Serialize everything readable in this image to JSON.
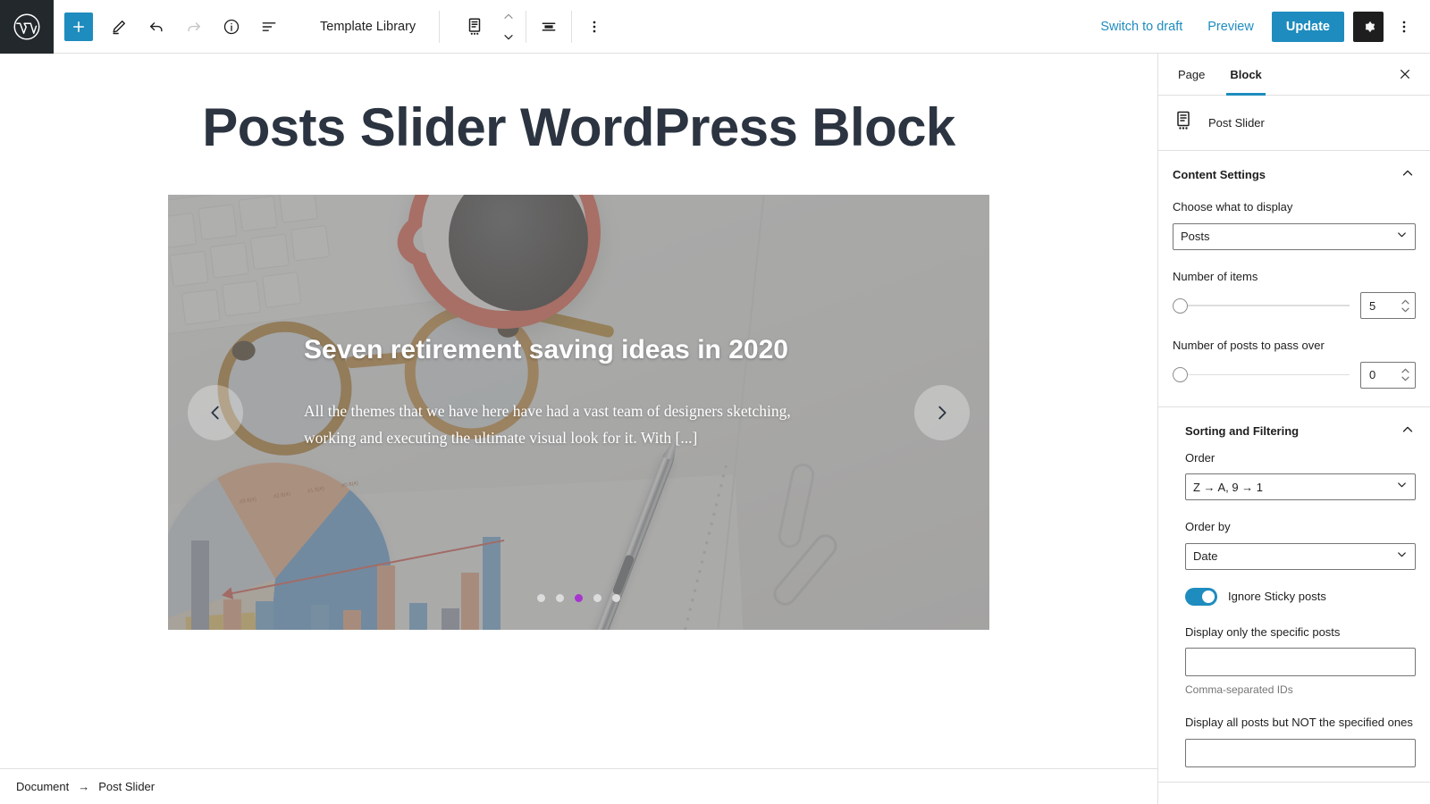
{
  "topbar": {
    "logo_icon": "wordpress-logo-icon",
    "add_block_label": "+",
    "tools_icon": "pencil-tools-icon",
    "undo_icon": "undo-icon",
    "redo_icon": "redo-icon",
    "info_icon": "info-circle-icon",
    "list_view_icon": "list-view-icon",
    "template_library_label": "Template Library",
    "block_icon": "post-slider-block-icon",
    "move_up_icon": "chevron-up-icon",
    "move_down_icon": "chevron-down-icon",
    "align_icon": "align-center-icon",
    "block_options_icon": "vertical-ellipsis-icon",
    "switch_to_draft_label": "Switch to draft",
    "preview_label": "Preview",
    "update_label": "Update",
    "settings_gear_icon": "gear-icon",
    "more_options_icon": "vertical-ellipsis-icon"
  },
  "canvas": {
    "page_title": "Posts Slider WordPress Block",
    "slider": {
      "prev_icon": "chevron-left-icon",
      "next_icon": "chevron-right-icon",
      "slide_title": "Seven retirement saving ideas in 2020",
      "slide_excerpt": "All the themes that we have here have had a vast team of designers sketching, working and executing the ultimate visual look for it. With [...]",
      "dot_count": 5,
      "active_dot_index": 2,
      "active_dot_color": "#a735d0",
      "inactive_dot_color": "#dcdcdc"
    }
  },
  "sidebar": {
    "tabs": [
      {
        "label": "Page",
        "active": false
      },
      {
        "label": "Block",
        "active": true
      }
    ],
    "close_icon": "close-icon",
    "block": {
      "icon": "post-slider-block-icon",
      "name": "Post Slider"
    },
    "panels": [
      {
        "title": "Content Settings",
        "toggle_icon": "chevron-up-icon",
        "expanded": true
      },
      {
        "title": "Sorting and Filtering",
        "toggle_icon": "chevron-up-icon",
        "expanded": true
      }
    ],
    "content_settings": {
      "choose_what_to_display": {
        "label": "Choose what to display",
        "value": "Posts",
        "caret_icon": "chevron-down-icon"
      },
      "number_of_items": {
        "label": "Number of items",
        "value": "5",
        "slider_position_percent": 0
      },
      "number_of_posts_to_pass_over": {
        "label": "Number of posts to pass over",
        "value": "0",
        "slider_position_percent": 0
      }
    },
    "sorting_and_filtering": {
      "order": {
        "label": "Order",
        "value": "Z → A, 9 → 1",
        "caret_icon": "chevron-down-icon"
      },
      "order_by": {
        "label": "Order by",
        "value": "Date",
        "caret_icon": "chevron-down-icon"
      },
      "ignore_sticky_posts": {
        "label": "Ignore Sticky posts",
        "checked": true
      },
      "display_only_specific": {
        "label": "Display only the specific posts",
        "value": "",
        "help": "Comma-separated IDs"
      },
      "display_all_but_not": {
        "label": "Display all posts but NOT the specified ones",
        "value": ""
      }
    }
  },
  "footer": {
    "breadcrumb": [
      "Document",
      "Post Slider"
    ],
    "separator": "→"
  },
  "colors": {
    "accent_blue": "#1e8cbe",
    "dark": "#1e1e1e",
    "border": "#e0e0e0"
  }
}
